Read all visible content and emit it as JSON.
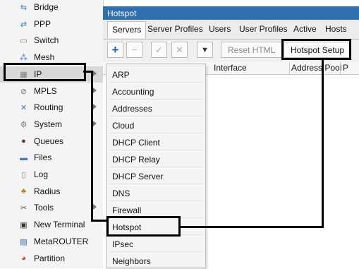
{
  "sidebar": {
    "items": [
      {
        "label": "Bridge",
        "icon": "bridge-icon",
        "glyph": "⇆",
        "color": "#4a7fc0"
      },
      {
        "label": "PPP",
        "icon": "ppp-icon",
        "glyph": "⇄",
        "color": "#4a7fc0"
      },
      {
        "label": "Switch",
        "icon": "switch-icon",
        "glyph": "▭",
        "color": "#6a6a6a"
      },
      {
        "label": "Mesh",
        "icon": "mesh-icon",
        "glyph": "⁂",
        "color": "#4a7fc0"
      },
      {
        "label": "IP",
        "icon": "ip-icon",
        "glyph": "▦",
        "color": "#7a7a7a",
        "submenu": true
      },
      {
        "label": "MPLS",
        "icon": "mpls-icon",
        "glyph": "⊘",
        "color": "#7a7a7a",
        "submenu": true
      },
      {
        "label": "Routing",
        "icon": "routing-icon",
        "glyph": "✕",
        "color": "#3a7fd0",
        "submenu": true
      },
      {
        "label": "System",
        "icon": "system-icon",
        "glyph": "⚙",
        "color": "#777777",
        "submenu": true
      },
      {
        "label": "Queues",
        "icon": "queues-icon",
        "glyph": "●",
        "color": "#5a3a2a"
      },
      {
        "label": "Files",
        "icon": "files-icon",
        "glyph": "▬",
        "color": "#3f7ec0"
      },
      {
        "label": "Log",
        "icon": "log-icon",
        "glyph": "▯",
        "color": "#777777"
      },
      {
        "label": "Radius",
        "icon": "radius-icon",
        "glyph": "♣",
        "color": "#c27a1a"
      },
      {
        "label": "Tools",
        "icon": "tools-icon",
        "glyph": "✂",
        "color": "#555555",
        "submenu": true
      },
      {
        "label": "New Terminal",
        "icon": "terminal-icon",
        "glyph": "▣",
        "color": "#333333"
      },
      {
        "label": "MetaROUTER",
        "icon": "metarouter-icon",
        "glyph": "▤",
        "color": "#2a5fa0"
      },
      {
        "label": "Partition",
        "icon": "partition-icon",
        "glyph": "◕",
        "color": "#d23a2a"
      }
    ],
    "selected": "IP"
  },
  "window": {
    "title": "Hotspot",
    "tabs": [
      "Servers",
      "Server Profiles",
      "Users",
      "User Profiles",
      "Active",
      "Hosts"
    ],
    "active_tab": "Servers",
    "toolbar": {
      "add": "+",
      "remove": "−",
      "enable": "✓",
      "disable": "✕",
      "filter": "▼",
      "reset_html": "Reset HTML",
      "hotspot_setup": "Hotspot Setup"
    },
    "columns": [
      "Interface",
      "Address Pool",
      "P"
    ]
  },
  "submenu": {
    "items": [
      "ARP",
      "Accounting",
      "Addresses",
      "Cloud",
      "DHCP Client",
      "DHCP Relay",
      "DHCP Server",
      "DNS",
      "Firewall",
      "Hotspot",
      "IPsec",
      "Neighbors"
    ]
  },
  "colors": {
    "title_bar": "#2f6fb0",
    "add_button": "#1f5fbf",
    "highlight": "#000000"
  }
}
